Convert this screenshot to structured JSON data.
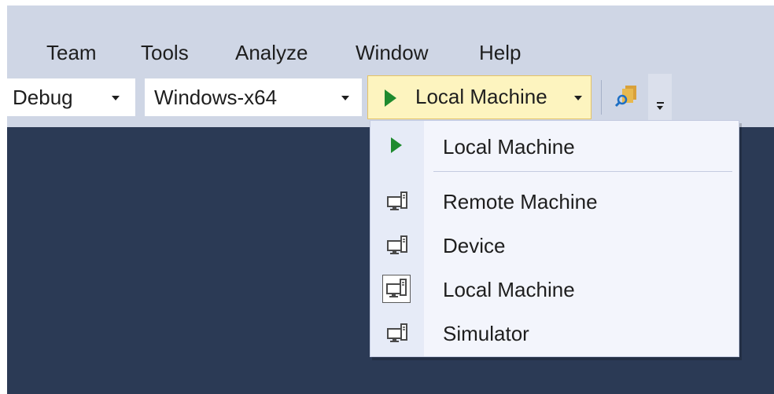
{
  "menubar": {
    "items": [
      "Team",
      "Tools",
      "Analyze",
      "Window",
      "Help"
    ]
  },
  "toolbar": {
    "config_value": "Debug",
    "platform_value": "Windows-x64",
    "run_target_label": "Local Machine"
  },
  "target_menu": {
    "items": [
      {
        "label": "Local Machine",
        "icon": "play-icon"
      },
      {
        "label": "Remote Machine",
        "icon": "computer-icon"
      },
      {
        "label": "Device",
        "icon": "computer-icon"
      },
      {
        "label": "Local Machine",
        "icon": "computer-icon",
        "checked": true
      },
      {
        "label": "Simulator",
        "icon": "computer-icon"
      }
    ]
  },
  "colors": {
    "editor_background": "#2b3a55",
    "chrome_background": "#cfd6e5",
    "run_button_background": "#fdf4bf",
    "play_green": "#1e8a2e"
  }
}
